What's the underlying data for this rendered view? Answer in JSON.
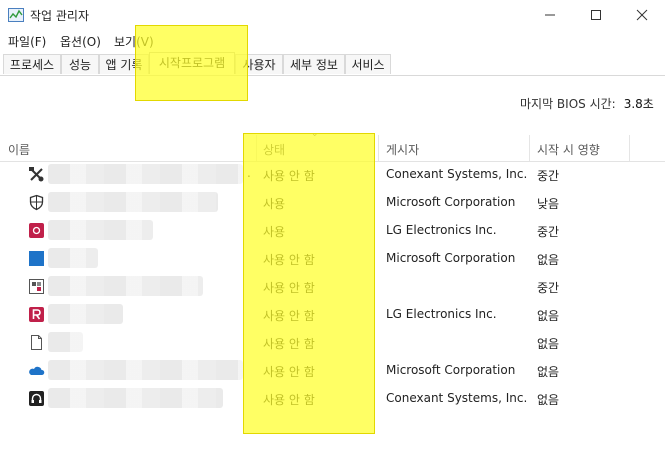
{
  "window": {
    "title": "작업 관리자"
  },
  "menu": [
    "파일(F)",
    "옵션(O)",
    "보기(V)"
  ],
  "tabs": [
    "프로세스",
    "성능",
    "앱 기록",
    "시작프로그램",
    "사용자",
    "세부 정보",
    "서비스"
  ],
  "active_tab": "시작프로그램",
  "bios": {
    "label": "마지막 BIOS 시간:",
    "value": "3.8초"
  },
  "columns": {
    "name": "이름",
    "status": "상태",
    "publisher": "게시자",
    "impact": "시작 시 영향"
  },
  "rows": [
    {
      "icon": "tools-icon",
      "status": "사용 안 함",
      "publisher": "Conexant Systems, Inc.",
      "impact": "중간"
    },
    {
      "icon": "shield-icon",
      "status": "사용",
      "publisher": "Microsoft Corporation",
      "impact": "낮음"
    },
    {
      "icon": "lg-app-icon",
      "status": "사용",
      "publisher": "LG Electronics Inc.",
      "impact": "중간"
    },
    {
      "icon": "blue-square-icon",
      "status": "사용 안 함",
      "publisher": "Microsoft Corporation",
      "impact": "없음"
    },
    {
      "icon": "grid-app-icon",
      "status": "사용 안 함",
      "publisher": "",
      "impact": "중간"
    },
    {
      "icon": "r-app-icon",
      "status": "사용 안 함",
      "publisher": "LG Electronics Inc.",
      "impact": "없음"
    },
    {
      "icon": "file-icon",
      "status": "사용 안 함",
      "publisher": "",
      "impact": "없음"
    },
    {
      "icon": "onedrive-icon",
      "status": "사용 안 함",
      "publisher": "Microsoft Corporation",
      "impact": "없음"
    },
    {
      "icon": "headset-icon",
      "status": "사용 안 함",
      "publisher": "Conexant Systems, Inc.",
      "impact": "없음"
    }
  ],
  "colors": {
    "highlight": "#ffff28",
    "onedrive": "#1e73c8",
    "lg_red": "#c0204a"
  }
}
